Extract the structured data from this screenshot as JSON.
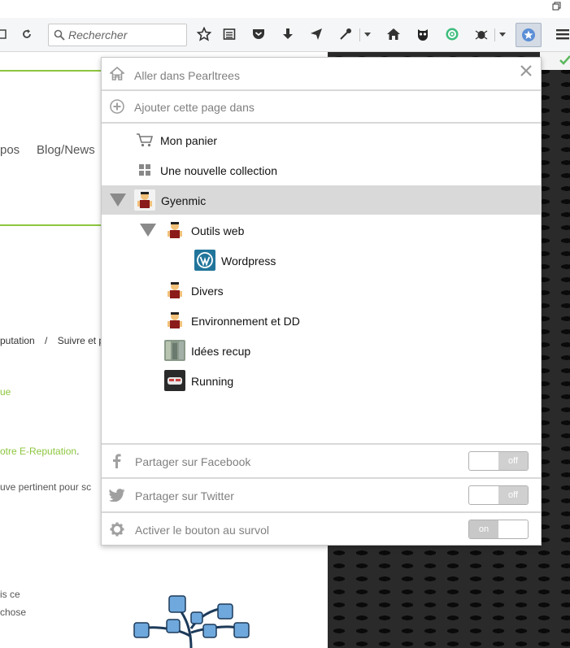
{
  "browser": {
    "search_placeholder": "Rechercher"
  },
  "website": {
    "nav_items": [
      "pos",
      "Blog/News"
    ],
    "breadcrumb": [
      "putation",
      "/",
      "Suivre et p"
    ],
    "snippets": {
      "green_1": "ue",
      "green_2": "otre E-Reputation",
      "green_2_suffix": ".",
      "gray_1": "uve pertinent pour sc",
      "gray_2": "is ce",
      "gray_3": "chose"
    }
  },
  "panel": {
    "goto_label": "Aller dans Pearltrees",
    "add_label": "Ajouter cette page dans",
    "cart_label": "Mon panier",
    "new_collection_label": "Une nouvelle collection",
    "tree": [
      {
        "label": "Gyenmic"
      },
      {
        "label": "Outils web"
      },
      {
        "label": "Wordpress"
      },
      {
        "label": "Divers"
      },
      {
        "label": "Environnement et DD"
      },
      {
        "label": "Idées recup"
      },
      {
        "label": "Running"
      }
    ],
    "share": [
      {
        "label": "Partager sur Facebook",
        "state": "off"
      },
      {
        "label": "Partager sur Twitter",
        "state": "off"
      },
      {
        "label": "Activer le bouton au survol",
        "state": "on"
      }
    ]
  },
  "colors": {
    "accent_green": "#8dc63f",
    "selected_row": "#d9d9d9",
    "wordpress_blue": "#21759b"
  }
}
